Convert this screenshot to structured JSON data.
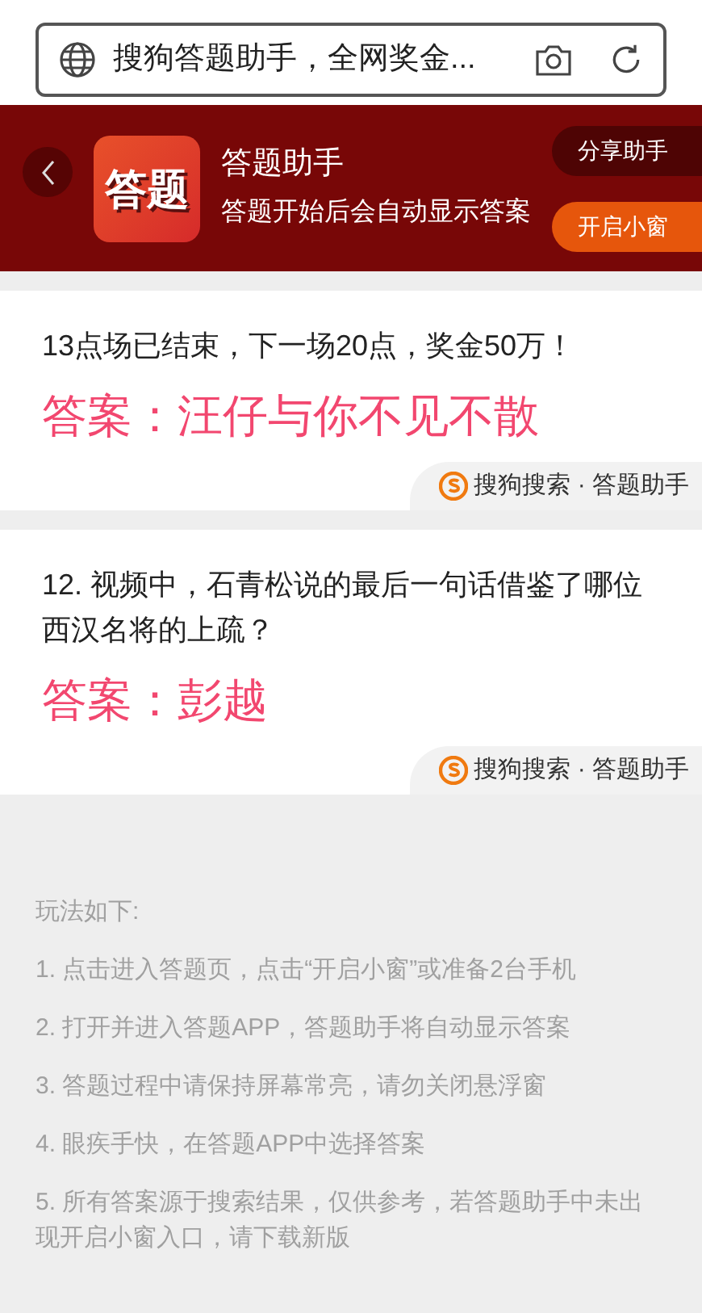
{
  "search_bar": {
    "text": "搜狗答题助手，全网奖金..."
  },
  "banner": {
    "title": "答题助手",
    "subtitle": "答题开始后会自动显示答案",
    "app_icon_text": "答题",
    "share_button": "分享助手",
    "small_window_button": "开启小窗"
  },
  "cards": [
    {
      "question": "13点场已结束，下一场20点，奖金50万！",
      "answer": "答案：汪仔与你不见不散",
      "source": "搜狗搜索 · 答题助手"
    },
    {
      "question": "12. 视频中，石青松说的最后一句话借鉴了哪位西汉名将的上疏？",
      "answer": "答案：彭越",
      "source": "搜狗搜索 · 答题助手"
    }
  ],
  "instructions": {
    "heading": "玩法如下:",
    "steps": [
      "1. 点击进入答题页，点击“开启小窗”或准备2台手机",
      "2. 打开并进入答题APP，答题助手将自动显示答案",
      "3. 答题过程中请保持屏幕常亮，请勿关闭悬浮窗",
      "4. 眼疾手快，在答题APP中选择答案",
      "5. 所有答案源于搜索结果，仅供参考，若答题助手中未出现开启小窗入口，请下载新版"
    ]
  }
}
